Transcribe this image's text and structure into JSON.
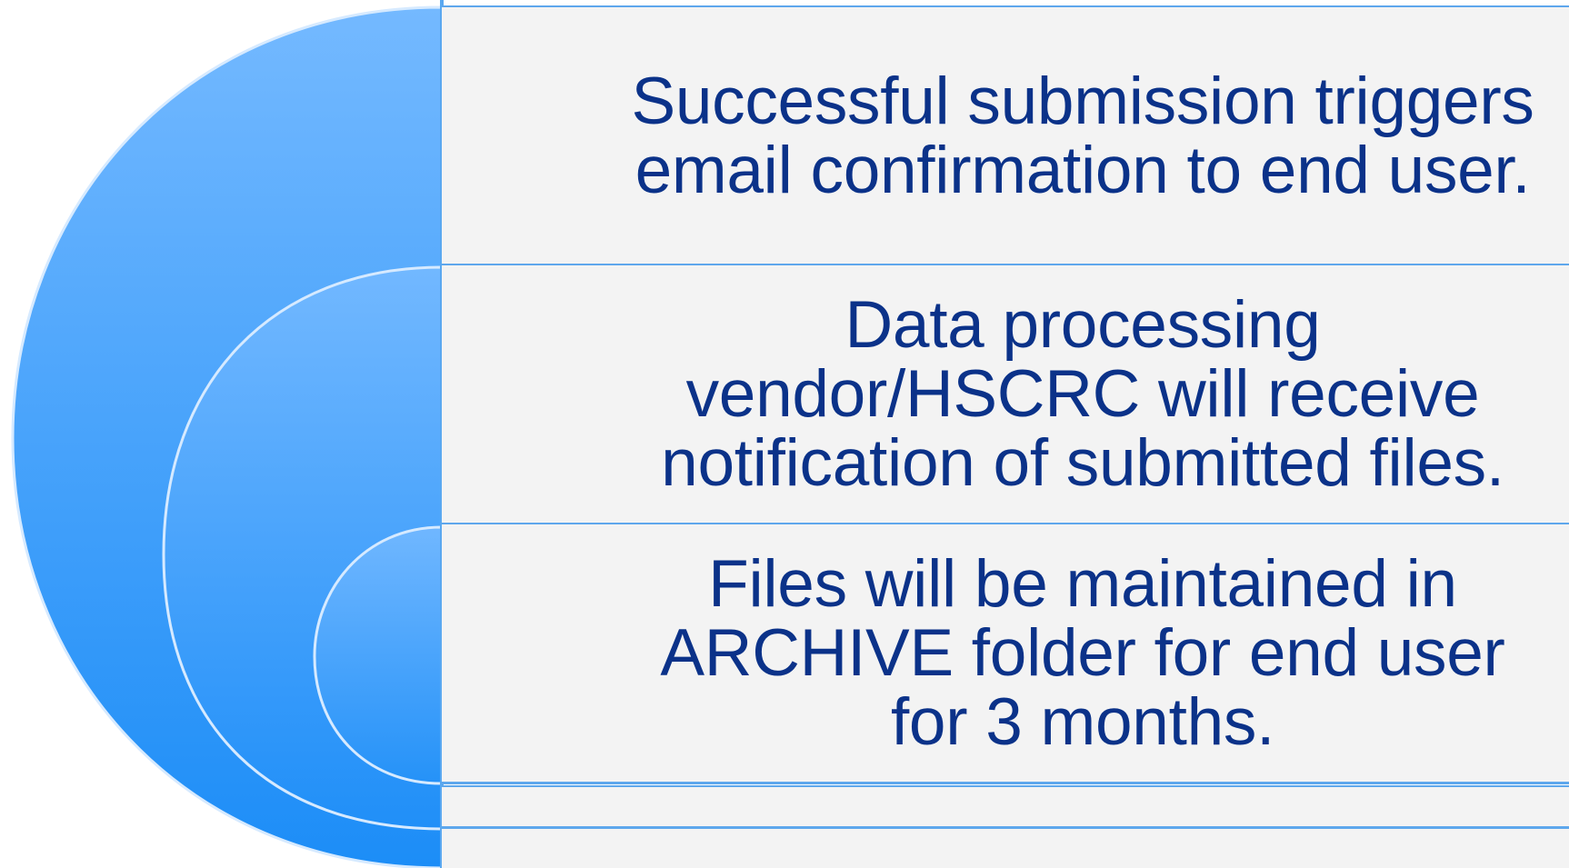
{
  "diagram": {
    "items": [
      {
        "text": "Successful submission triggers email confirmation to end user."
      },
      {
        "text": "Data processing vendor/HSCRC will receive notification of submitted files."
      },
      {
        "text": "Files will be maintained in ARCHIVE folder for end user for 3 months."
      }
    ]
  },
  "colors": {
    "arc_top": "#6fb6ff",
    "arc_bottom": "#1f8ff8",
    "arc_outline": "#cfe6ff",
    "panel_bg": "#f3f3f3",
    "panel_border": "#5ea7ec",
    "text": "#0b3289"
  }
}
